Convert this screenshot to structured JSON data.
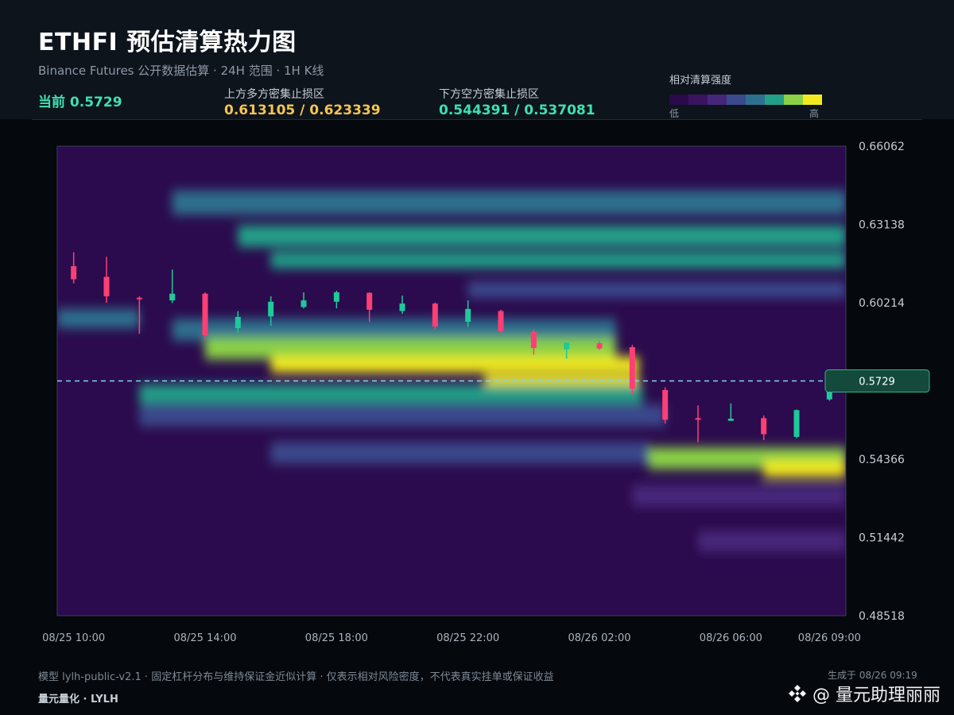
{
  "header": {
    "title": "ETHFI 预估清算热力图",
    "subtitle": "Binance Futures 公开数据估算 · 24H 范围 · 1H K线",
    "current_label": "当前 0.5729",
    "upper_label": "上方多方密集止损区",
    "upper_value": "0.613105 / 0.623339",
    "lower_label": "下方空方密集止损区",
    "lower_value": "0.544391 / 0.537081"
  },
  "legend": {
    "title": "相对清算强度",
    "low": "低",
    "high": "高",
    "colors": [
      "#2a0a4a",
      "#3a1460",
      "#46267a",
      "#3b4a8c",
      "#2f6f8e",
      "#22a088",
      "#8ad147",
      "#f2ea1e"
    ]
  },
  "footer": {
    "note": "模型 lylh-public-v2.1 · 固定杠杆分布与维持保证金近似计算 · 仅表示相对风险密度，不代表真实挂单或保证收益",
    "brand": "量元量化 · LYLH",
    "generated": "生成于 08/26 09:19",
    "watermark": "@ 量元助理丽丽"
  },
  "colors": {
    "up": "#1fc99a",
    "down": "#ff3f74",
    "current_line": "#7fd8e8",
    "tag_bg": "#134a3c",
    "tag_border": "#2fb58a"
  },
  "chart_data": {
    "type": "heatmap",
    "overlay": "candlestick",
    "title": "ETHFI 预估清算热力图",
    "y_ticks": [
      "0.66062",
      "0.63138",
      "0.60214",
      "0.57290",
      "0.54366",
      "0.51442",
      "0.48518"
    ],
    "y_tick_labels": [
      "0.66062",
      "0.63138",
      "0.60214",
      "0.5729",
      "0.54366",
      "0.51442",
      "0.48518"
    ],
    "ylim": [
      0.48518,
      0.66062
    ],
    "x_tick_labels": [
      "08/25 10:00",
      "08/25 14:00",
      "08/25 18:00",
      "08/25 22:00",
      "08/26 02:00",
      "08/26 06:00",
      "08/26 09:00"
    ],
    "x_tick_hours": [
      0,
      4,
      8,
      12,
      16,
      20,
      23
    ],
    "xlim_hours": [
      -0.5,
      23.5
    ],
    "current_price": 0.5729,
    "current_tag": "0.5729",
    "candles": [
      {
        "t": "08/25 10:00",
        "o": 0.6158,
        "h": 0.621,
        "l": 0.6093,
        "c": 0.6109
      },
      {
        "t": "08/25 11:00",
        "o": 0.6118,
        "h": 0.6193,
        "l": 0.6021,
        "c": 0.6045
      },
      {
        "t": "08/25 12:00",
        "o": 0.604,
        "h": 0.6045,
        "l": 0.5905,
        "c": 0.6038
      },
      {
        "t": "08/25 13:00",
        "o": 0.603,
        "h": 0.6145,
        "l": 0.602,
        "c": 0.6055
      },
      {
        "t": "08/25 14:00",
        "o": 0.6055,
        "h": 0.606,
        "l": 0.5886,
        "c": 0.59
      },
      {
        "t": "08/25 15:00",
        "o": 0.5926,
        "h": 0.599,
        "l": 0.591,
        "c": 0.5968
      },
      {
        "t": "08/25 16:00",
        "o": 0.597,
        "h": 0.6045,
        "l": 0.5935,
        "c": 0.6025
      },
      {
        "t": "08/25 17:00",
        "o": 0.6005,
        "h": 0.606,
        "l": 0.6,
        "c": 0.603
      },
      {
        "t": "08/25 18:00",
        "o": 0.6025,
        "h": 0.6066,
        "l": 0.6,
        "c": 0.606
      },
      {
        "t": "08/25 19:00",
        "o": 0.6058,
        "h": 0.606,
        "l": 0.595,
        "c": 0.5995
      },
      {
        "t": "08/25 20:00",
        "o": 0.599,
        "h": 0.6048,
        "l": 0.598,
        "c": 0.6018
      },
      {
        "t": "08/25 21:00",
        "o": 0.6018,
        "h": 0.6022,
        "l": 0.592,
        "c": 0.5932
      },
      {
        "t": "08/25 22:00",
        "o": 0.595,
        "h": 0.603,
        "l": 0.593,
        "c": 0.5998
      },
      {
        "t": "08/25 23:00",
        "o": 0.599,
        "h": 0.5995,
        "l": 0.591,
        "c": 0.5915
      },
      {
        "t": "08/26 00:00",
        "o": 0.5913,
        "h": 0.5922,
        "l": 0.5827,
        "c": 0.5852
      },
      {
        "t": "08/26 01:00",
        "o": 0.5847,
        "h": 0.5872,
        "l": 0.5812,
        "c": 0.5872
      },
      {
        "t": "08/26 02:00",
        "o": 0.587,
        "h": 0.5878,
        "l": 0.5845,
        "c": 0.585
      },
      {
        "t": "08/26 03:00",
        "o": 0.5855,
        "h": 0.5863,
        "l": 0.5678,
        "c": 0.57
      },
      {
        "t": "08/26 04:00",
        "o": 0.5695,
        "h": 0.5705,
        "l": 0.557,
        "c": 0.5584
      },
      {
        "t": "08/26 05:00",
        "o": 0.559,
        "h": 0.5638,
        "l": 0.55,
        "c": 0.5585
      },
      {
        "t": "08/26 06:00",
        "o": 0.558,
        "h": 0.5645,
        "l": 0.558,
        "c": 0.5588
      },
      {
        "t": "08/26 07:00",
        "o": 0.559,
        "h": 0.56,
        "l": 0.5508,
        "c": 0.553
      },
      {
        "t": "08/26 08:00",
        "o": 0.552,
        "h": 0.5622,
        "l": 0.5515,
        "c": 0.562
      },
      {
        "t": "08/26 09:00",
        "o": 0.566,
        "h": 0.5735,
        "l": 0.5655,
        "c": 0.5729
      }
    ],
    "liquidation_bands": [
      {
        "price": 0.6395,
        "t_start": 3,
        "t_end": 23.5,
        "intensity": 0.5,
        "width": 0.0045
      },
      {
        "price": 0.627,
        "t_start": 5,
        "t_end": 23.5,
        "intensity": 0.72,
        "width": 0.004
      },
      {
        "price": 0.618,
        "t_start": 6,
        "t_end": 23.5,
        "intensity": 0.7,
        "width": 0.003
      },
      {
        "price": 0.607,
        "t_start": 12,
        "t_end": 23.5,
        "intensity": 0.4,
        "width": 0.003
      },
      {
        "price": 0.5962,
        "t_start": -0.5,
        "t_end": 2.0,
        "intensity": 0.5,
        "width": 0.0035
      },
      {
        "price": 0.592,
        "t_start": 3,
        "t_end": 16.5,
        "intensity": 0.62,
        "width": 0.004
      },
      {
        "price": 0.585,
        "t_start": 4,
        "t_end": 16.5,
        "intensity": 0.8,
        "width": 0.004
      },
      {
        "price": 0.579,
        "t_start": 6,
        "t_end": 17.2,
        "intensity": 0.94,
        "width": 0.003
      },
      {
        "price": 0.573,
        "t_start": 12.5,
        "t_end": 17.2,
        "intensity": 1.0,
        "width": 0.0022
      },
      {
        "price": 0.568,
        "t_start": 2,
        "t_end": 17.3,
        "intensity": 0.66,
        "width": 0.0035
      },
      {
        "price": 0.56,
        "t_start": 2,
        "t_end": 18.0,
        "intensity": 0.45,
        "width": 0.004
      },
      {
        "price": 0.546,
        "t_start": 6,
        "t_end": 17.5,
        "intensity": 0.4,
        "width": 0.004
      },
      {
        "price": 0.544,
        "t_start": 17.5,
        "t_end": 23.5,
        "intensity": 0.82,
        "width": 0.004
      },
      {
        "price": 0.54,
        "t_start": 21,
        "t_end": 23.5,
        "intensity": 0.95,
        "width": 0.003
      },
      {
        "price": 0.53,
        "t_start": 17,
        "t_end": 23.5,
        "intensity": 0.35,
        "width": 0.004
      },
      {
        "price": 0.513,
        "t_start": 19,
        "t_end": 23.5,
        "intensity": 0.32,
        "width": 0.004
      }
    ]
  }
}
